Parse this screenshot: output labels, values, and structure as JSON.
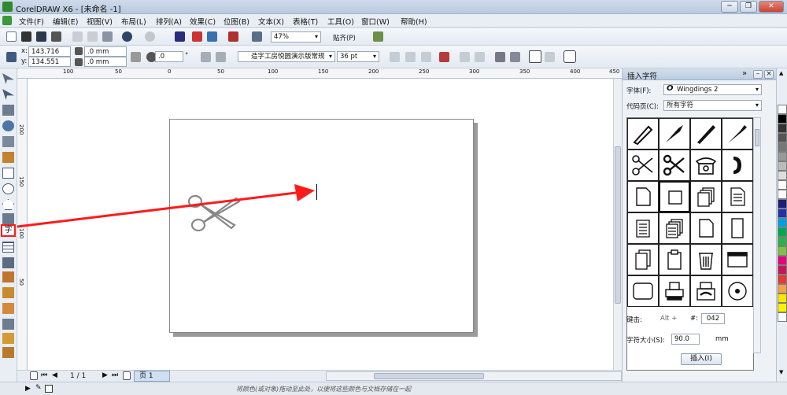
{
  "window": {
    "title": "CorelDRAW X6 - [未命名 -1]",
    "minimize": "─",
    "restore": "❐",
    "close": "✕"
  },
  "menu": {
    "items": [
      "文件(F)",
      "编辑(E)",
      "视图(V)",
      "布局(L)",
      "排列(A)",
      "效果(C)",
      "位图(B)",
      "文本(X)",
      "表格(T)",
      "工具(O)",
      "窗口(W)",
      "帮助(H)"
    ]
  },
  "standard_toolbar": {
    "zoom": "47%",
    "snap_label": "贴齐(P)"
  },
  "property_bar": {
    "x_label": "x:",
    "x_value": "143.716 mm",
    "y_label": "y:",
    "y_value": "134.551 mm",
    "w_value": ".0 mm",
    "h_value": ".0 mm",
    "angle_value": ".0",
    "angle_unit": "°",
    "font_name": "造字工房悦圆演示版常规",
    "font_size": "36 pt"
  },
  "ruler": {
    "h_ticks": [
      "100",
      "50",
      "0",
      "50",
      "100",
      "150",
      "200",
      "250",
      "300",
      "350",
      "400",
      "450"
    ],
    "v_ticks": [
      "200",
      "150",
      "100",
      "50"
    ]
  },
  "status": {
    "page_counter": "1 / 1",
    "page_tab": "页 1",
    "hint": "将颜色(或对象)拖动至此处，以便将这些颜色与文档存储在一起"
  },
  "docker": {
    "title": "插入字符",
    "font_label": "字体(F):",
    "font_value": "Wingdings 2",
    "codepage_label": "代码页(C):",
    "codepage_value": "所有字符",
    "key_label": "键击:",
    "key_prefix": "Alt +",
    "key_hash": "#:",
    "key_code": "042",
    "size_label": "字符大小(S):",
    "size_value": "90.0",
    "size_unit": "mm",
    "insert_button": "插入(I)"
  },
  "colors": {
    "accent_red": "#ff1a1a",
    "title_bg": "#c3d3e6"
  }
}
